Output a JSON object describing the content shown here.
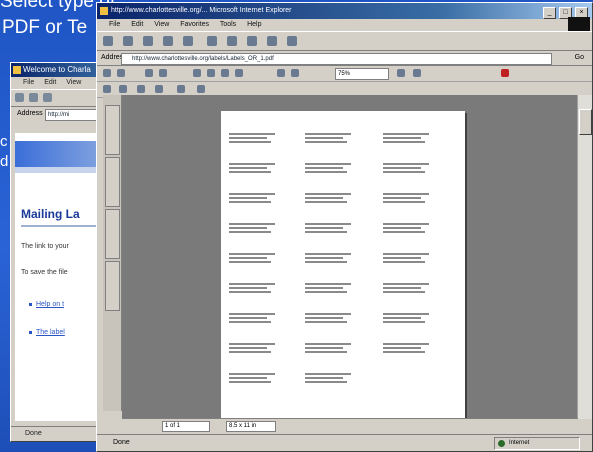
{
  "slide": {
    "line1": "Select type of",
    "line2": "PDF or Te",
    "line3": "c",
    "line4": "d"
  },
  "back_window": {
    "title": "Welcome to Charla",
    "menu": "File Edit View",
    "address_label": "Address",
    "address_value": "http://mi",
    "heading": "Mailing La",
    "para1": "The link to your",
    "para2": "To save the file",
    "link1": "Help on t",
    "link2": "The label",
    "status": "Done"
  },
  "front_window": {
    "title": "http://www.charlottesville.org/... Microsoft Internet Explorer",
    "menu": "File Edit View Favorites Tools Help",
    "address_label": "Address",
    "address_value": "http://www.charlottesville.org/labels/Labels_OR_1.pdf",
    "go_label": "Go",
    "zoom_value": "75%",
    "page_indicator": "1 of 1",
    "page_size": "8.5 x 11 in",
    "status_left": "Done",
    "status_zone": "Internet",
    "window_buttons": [
      "_",
      "□",
      "×"
    ],
    "pdf_label_rows": 9,
    "pdf_label_cols": 3
  }
}
